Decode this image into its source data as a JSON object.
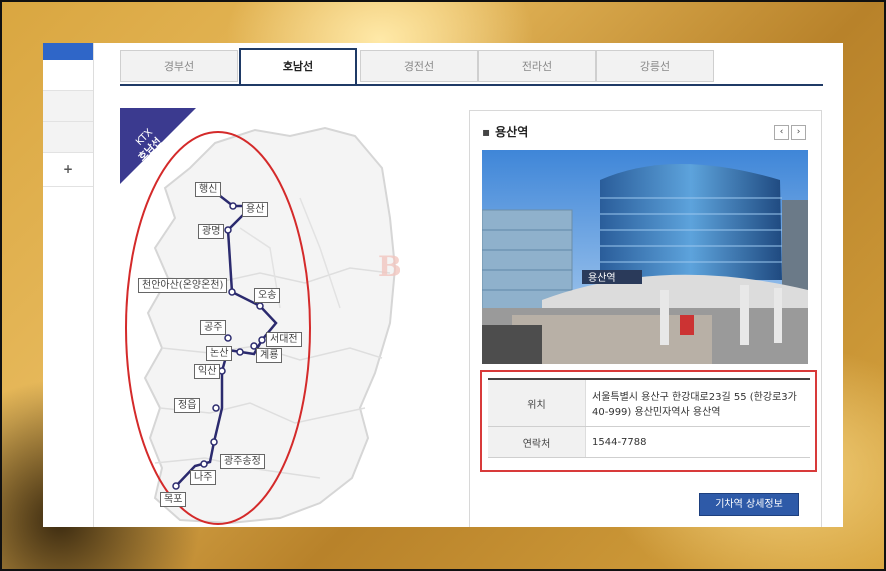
{
  "tabs": [
    {
      "label": "경부선",
      "active": false
    },
    {
      "label": "호남선",
      "active": true
    },
    {
      "label": "경전선",
      "active": false
    },
    {
      "label": "전라선",
      "active": false
    },
    {
      "label": "강릉선",
      "active": false
    }
  ],
  "sidebar": {
    "plus_label": "+"
  },
  "map": {
    "ribbon_line1": "KTX",
    "ribbon_line2": "호남선",
    "watermark": "BOOK",
    "stations": [
      {
        "name": "행신"
      },
      {
        "name": "용산"
      },
      {
        "name": "광명"
      },
      {
        "name": "천안아산(온양온천)"
      },
      {
        "name": "오송"
      },
      {
        "name": "공주"
      },
      {
        "name": "서대전"
      },
      {
        "name": "논산"
      },
      {
        "name": "계룡"
      },
      {
        "name": "익산"
      },
      {
        "name": "정읍"
      },
      {
        "name": "광주송정"
      },
      {
        "name": "나주"
      },
      {
        "name": "목포"
      }
    ]
  },
  "station_info": {
    "title": "용산역",
    "prev_label": "‹",
    "next_label": "›",
    "photo_sign": "용산역",
    "location_label": "위치",
    "location_value": "서울특별시 용산구 한강대로23길 55 (한강로3가 40-999) 용산민자역사 용산역",
    "contact_label": "연락처",
    "contact_value": "1544-7788",
    "detail_button": "기차역 상세정보"
  },
  "colors": {
    "tab_border": "#1f3a66",
    "route_line": "#2b2a6e",
    "highlight": "#d83a3a",
    "button": "#2e5aa8"
  }
}
